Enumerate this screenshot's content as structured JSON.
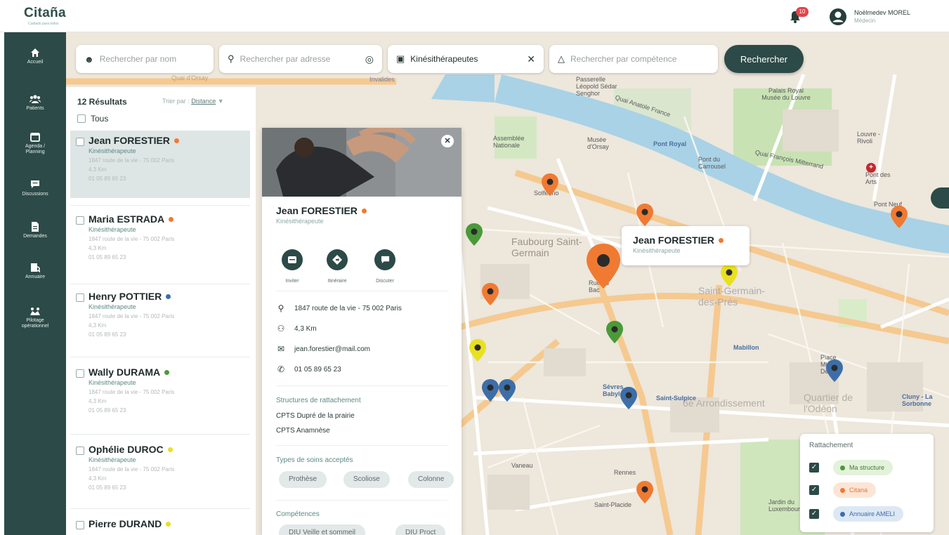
{
  "app": {
    "logo": "Citaña",
    "logo_sub": "Cuidado para todos",
    "notification_count": "10",
    "user_name": "Noëlmedev MOREL",
    "user_role": "Médecin"
  },
  "sidebar": {
    "items": [
      {
        "label": "Accueil",
        "icon": "home-icon"
      },
      {
        "label": "Patients",
        "icon": "users-icon"
      },
      {
        "label": "Agenda / Planning",
        "icon": "calendar-icon"
      },
      {
        "label": "Discussions",
        "icon": "chat-icon"
      },
      {
        "label": "Demandes",
        "icon": "document-icon"
      },
      {
        "label": "Annuaire",
        "icon": "directory-icon"
      },
      {
        "label": "Pilotage opérationnel",
        "icon": "pilot-icon"
      }
    ]
  },
  "search": {
    "name_placeholder": "Rechercher par nom",
    "address_placeholder": "Rechercher par adresse",
    "profession_value": "Kinésithérapeutes",
    "competence_placeholder": "Rechercher par compétence",
    "submit_label": "Rechercher"
  },
  "results": {
    "count": "12 Résultats",
    "sort_label": "Trier par :",
    "sort_value": "Distance",
    "all_label": "Tous",
    "items": [
      {
        "name": "Jean FORESTIER",
        "specialty": "Kinésithérapeute",
        "address": "1847 route de la vie - 75 002 Paris",
        "distance": "4,3 Km",
        "phone": "01 05 89 65 23",
        "status": "orange"
      },
      {
        "name": "Maria ESTRADA",
        "specialty": "Kinésithérapeute",
        "address": "1847 route de la vie - 75 002 Paris",
        "distance": "4,3 Km",
        "phone": "01 05 89 65 23",
        "status": "orange"
      },
      {
        "name": "Henry POTTIER",
        "specialty": "Kinésithérapeute",
        "address": "1847 route de la vie - 75 002 Paris",
        "distance": "4,3 Km",
        "phone": "01 05 89 65 23",
        "status": "blue"
      },
      {
        "name": "Wally DURAMA",
        "specialty": "Kinésithérapeute",
        "address": "1847 route de la vie - 75 002 Paris",
        "distance": "4,3 Km",
        "phone": "01 05 89 65 23",
        "status": "green"
      },
      {
        "name": "Ophélie DUROC",
        "specialty": "Kinésithérapeute",
        "address": "1847 route de la vie - 75 002 Paris",
        "distance": "4,3 Km",
        "phone": "01 05 89 65 23",
        "status": "yellow"
      },
      {
        "name": "Pierre DURAND",
        "specialty": "Kinésithérapeute",
        "address": "",
        "distance": "",
        "phone": "",
        "status": "yellow"
      }
    ]
  },
  "detail": {
    "name": "Jean FORESTIER",
    "specialty": "Kinésithérapeute",
    "actions": [
      {
        "label": "Inviter",
        "icon": "invite-icon"
      },
      {
        "label": "Itinéraire",
        "icon": "route-icon"
      },
      {
        "label": "Discuter",
        "icon": "chat-icon"
      }
    ],
    "address": "1847 route de la vie - 75 002 Paris",
    "distance": "4,3 Km",
    "email": "jean.forestier@mail.com",
    "phone": "01 05 89 65 23",
    "structures_title": "Structures de rattachement",
    "structures": [
      "CPTS Dupré de la prairie",
      "CPTS Anamnèse"
    ],
    "care_title": "Types de soins acceptés",
    "care_types": [
      "Prothèse",
      "Scoliose",
      "Colonne"
    ],
    "competences_title": "Compétences",
    "competences": [
      "DIU Veille et sommeil",
      "DIU Proct"
    ]
  },
  "map": {
    "labels": [
      "Invalides",
      "Quai d'Orsay",
      "Assemblée Nationale",
      "Musée d'Orsay",
      "Pont Royal",
      "Quai François Mitterrand",
      "Pont du Carrousel",
      "Palais Royal Musée du Louvre",
      "Louvre - Rivoli",
      "Pont des Arts",
      "Pont Neuf",
      "Faubourg Saint-Germain",
      "Saint-Germain-des-Prés",
      "Place Michel Debré",
      "6e Arrondissement",
      "Quartier de l'Odéon",
      "Vaneau",
      "Rennes",
      "Saint-Placide",
      "Sèvres Babylone",
      "Saint-Sulpice",
      "Mabillon",
      "Rue du Bac",
      "Passerelle Léopold Sédar Senghor",
      "Solférino",
      "Cluny - La Sorbonne",
      "Jardin du Luxembourg",
      "Quai Anatole France"
    ],
    "popup_name": "Jean FORESTIER",
    "popup_specialty": "Kinésithérapeute"
  },
  "legend": {
    "title": "Rattachement",
    "items": [
      {
        "label": "Ma structure",
        "color": "#4a9a3a"
      },
      {
        "label": "Citana",
        "color": "#f07a32"
      },
      {
        "label": "Annuaire AMELI",
        "color": "#3d6ea8"
      }
    ]
  },
  "colors": {
    "primary": "#2c4a47",
    "orange": "#f07a32",
    "blue": "#3d6ea8",
    "green": "#4a9a3a",
    "yellow": "#e9e020"
  }
}
